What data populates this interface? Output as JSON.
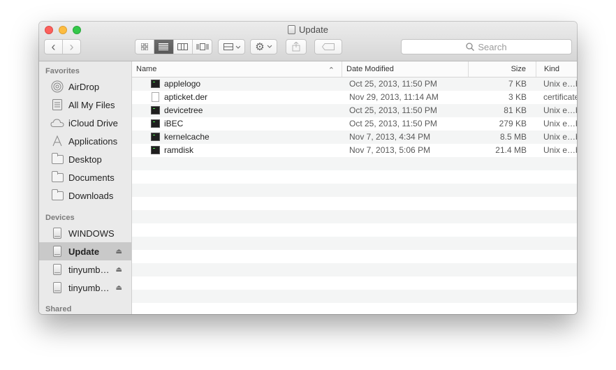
{
  "window": {
    "title": "Update"
  },
  "toolbar": {
    "back": "‹",
    "forward": "›",
    "search_placeholder": "Search"
  },
  "sidebar": {
    "favorites_label": "Favorites",
    "favorites": [
      {
        "label": "AirDrop",
        "icon": "airdrop-icon"
      },
      {
        "label": "All My Files",
        "icon": "all-files-icon"
      },
      {
        "label": "iCloud Drive",
        "icon": "cloud-icon"
      },
      {
        "label": "Applications",
        "icon": "applications-icon"
      },
      {
        "label": "Desktop",
        "icon": "folder-icon"
      },
      {
        "label": "Documents",
        "icon": "folder-icon"
      },
      {
        "label": "Downloads",
        "icon": "folder-icon"
      }
    ],
    "devices_label": "Devices",
    "devices": [
      {
        "label": "WINDOWS",
        "icon": "drive-icon",
        "eject": ""
      },
      {
        "label": "Update",
        "icon": "drive-icon",
        "eject": "⏏",
        "selected": true
      },
      {
        "label": "tinyumb…",
        "icon": "drive-icon",
        "eject": "⏏"
      },
      {
        "label": "tinyumb…",
        "icon": "drive-icon",
        "eject": "⏏"
      }
    ],
    "shared_label": "Shared"
  },
  "columns": {
    "name": "Name",
    "date": "Date Modified",
    "size": "Size",
    "kind": "Kind",
    "sort_indicator": "⌃"
  },
  "files": [
    {
      "name": "applelogo",
      "date": "Oct 25, 2013, 11:50 PM",
      "size": "7 KB",
      "kind": "Unix e…ble",
      "icon": "exec"
    },
    {
      "name": "apticket.der",
      "date": "Nov 29, 2013, 11:14 AM",
      "size": "3 KB",
      "kind": "certificate",
      "icon": "doc"
    },
    {
      "name": "devicetree",
      "date": "Oct 25, 2013, 11:50 PM",
      "size": "81 KB",
      "kind": "Unix e…ble",
      "icon": "exec"
    },
    {
      "name": "iBEC",
      "date": "Oct 25, 2013, 11:50 PM",
      "size": "279 KB",
      "kind": "Unix e…ble",
      "icon": "exec"
    },
    {
      "name": "kernelcache",
      "date": "Nov 7, 2013, 4:34 PM",
      "size": "8.5 MB",
      "kind": "Unix e…ble",
      "icon": "exec"
    },
    {
      "name": "ramdisk",
      "date": "Nov 7, 2013, 5:06 PM",
      "size": "21.4 MB",
      "kind": "Unix e…ble",
      "icon": "exec"
    }
  ]
}
